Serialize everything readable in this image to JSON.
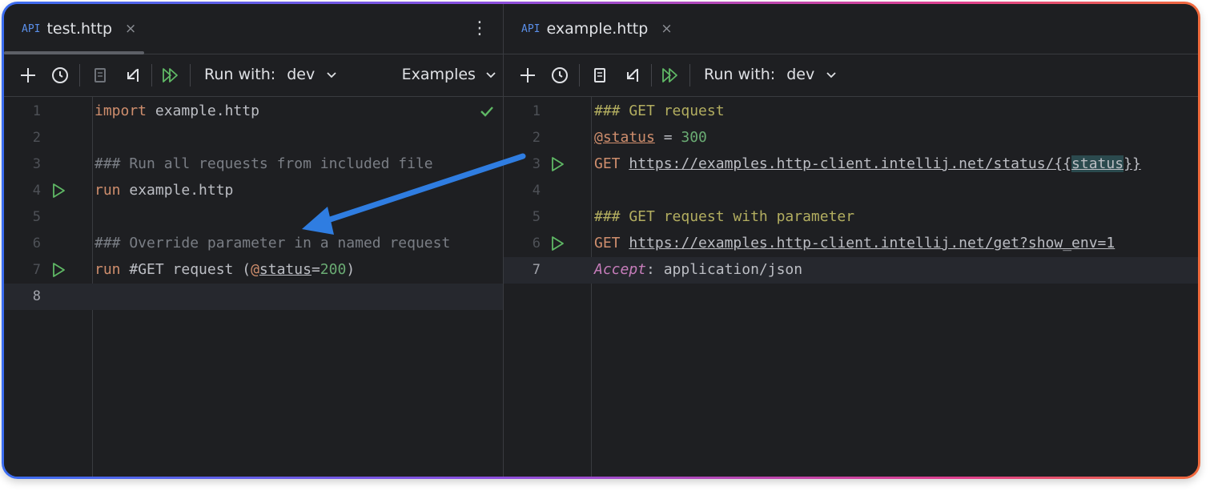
{
  "left_pane": {
    "tab": {
      "api_badge": "API",
      "name": "test.http",
      "close": "×"
    },
    "menu": "⋮",
    "toolbar": {
      "run_with_label": "Run with:",
      "env": "dev",
      "examples_label": "Examples"
    },
    "lines": [
      {
        "number": "1",
        "t1": "import",
        "t2": " example.http"
      },
      {
        "number": "2"
      },
      {
        "number": "3",
        "comment": "### Run all requests from included file"
      },
      {
        "number": "4",
        "t1": "run",
        "t2": " example.http"
      },
      {
        "number": "5"
      },
      {
        "number": "6",
        "comment": "### Override parameter in a named request"
      },
      {
        "number": "7",
        "t1": "run",
        "t2": " #GET request (",
        "t3": "@",
        "t4": "status",
        "t5": "=",
        "t6": "200",
        "t7": ")"
      },
      {
        "number": "8"
      }
    ]
  },
  "right_pane": {
    "tab": {
      "api_badge": "API",
      "name": "example.http",
      "close": "×"
    },
    "toolbar": {
      "run_with_label": "Run with:",
      "env": "dev"
    },
    "lines": [
      {
        "number": "1",
        "header": "### GET request"
      },
      {
        "number": "2",
        "t1": "@status",
        "t2": " = ",
        "t3": "300"
      },
      {
        "number": "3",
        "t1": "GET",
        "t2": " ",
        "url": "https://examples.http-client.intellij.net/status/{{",
        "urlvar": "status",
        "url_end": "}}"
      },
      {
        "number": "4"
      },
      {
        "number": "5",
        "header": "### GET request with parameter"
      },
      {
        "number": "6",
        "t1": "GET",
        "t2": " ",
        "url": "https://examples.http-client.intellij.net/get?show_env=1"
      },
      {
        "number": "7",
        "t1": "Accept",
        "t2": ": application/json"
      }
    ]
  },
  "colors": {
    "background": "#1e1f22",
    "keyword": "#cf8e6d",
    "comment": "#7a7e85",
    "request_header": "#b3ae60",
    "variable": "#c77dbb",
    "number": "#6aab73",
    "run_icon": "#5fb865",
    "annotation_arrow": "#2f7de1"
  }
}
